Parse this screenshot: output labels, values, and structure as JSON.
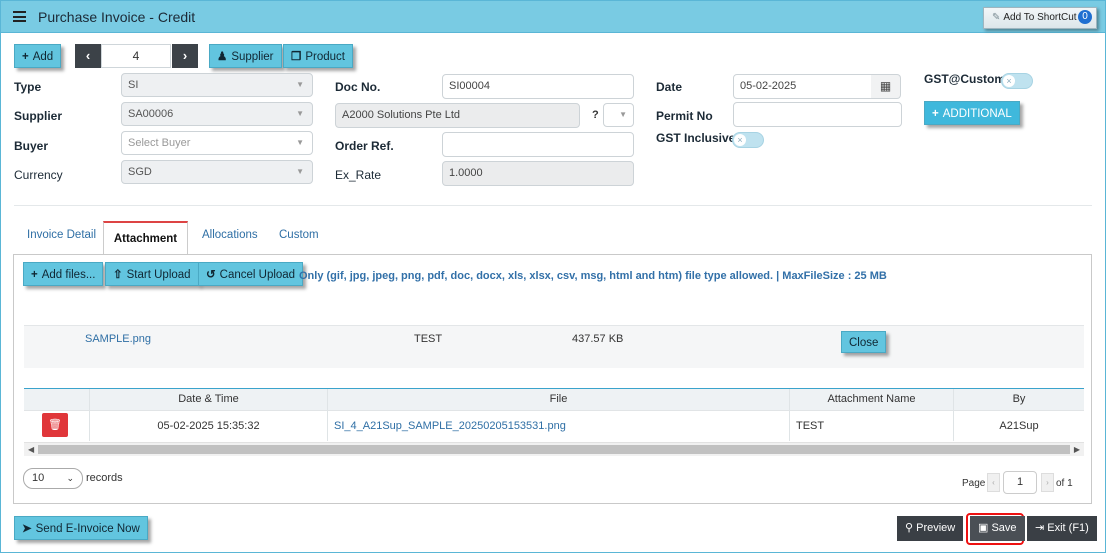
{
  "header": {
    "title": "Purchase Invoice - Credit",
    "shortcut_label": "Add To ShortCut",
    "shortcut_count": "0"
  },
  "toolbar": {
    "add": "Add",
    "record_no": "4",
    "supplier": "Supplier",
    "product": "Product"
  },
  "form": {
    "type_label": "Type",
    "type_value": "SI",
    "supplier_label": "Supplier",
    "supplier_value": "SA00006",
    "buyer_label": "Buyer",
    "buyer_placeholder": "Select Buyer",
    "currency_label": "Currency",
    "currency_value": "SGD",
    "docno_label": "Doc No.",
    "docno_value": "SI00004",
    "supplier_name": "A2000 Solutions Pte Ltd",
    "question": "?",
    "orderref_label": "Order Ref.",
    "orderref_value": "",
    "exrate_label": "Ex_Rate",
    "exrate_value": "1.0000",
    "date_label": "Date",
    "date_value": "05-02-2025",
    "permit_label": "Permit No",
    "permit_value": "",
    "gst_inclusive_label": "GST Inclusive",
    "gst_custom_label": "GST@Custom",
    "additional": "ADDITIONAL"
  },
  "tabs": [
    "Invoice Detail",
    "Attachment",
    "Allocations",
    "Custom"
  ],
  "attachment": {
    "add_files": "Add files...",
    "start_upload": "Start Upload",
    "cancel_upload": "Cancel Upload",
    "allowed_note": "Only (gif, jpg, jpeg, png, pdf, doc, docx, xls, xlsx, csv, msg, html and htm) file type allowed. | MaxFileSize : 25 MB",
    "file_name": "SAMPLE.png",
    "file_title": "TEST",
    "file_size": "437.57 KB",
    "close": "Close"
  },
  "grid": {
    "headers": [
      "Date & Time",
      "File",
      "Attachment Name",
      "By"
    ],
    "rows": [
      {
        "datetime": "05-02-2025 15:35:32",
        "file": "SI_4_A21Sup_SAMPLE_20250205153531.png",
        "name": "TEST",
        "by": "A21Sup"
      }
    ]
  },
  "paging": {
    "page_size": "10",
    "records_label": "records",
    "page_label": "Page",
    "page_num": "1",
    "of_label": "of 1"
  },
  "footer": {
    "send": "Send E-Invoice Now",
    "preview": "Preview",
    "save": "Save",
    "exit": "Exit (F1)"
  }
}
